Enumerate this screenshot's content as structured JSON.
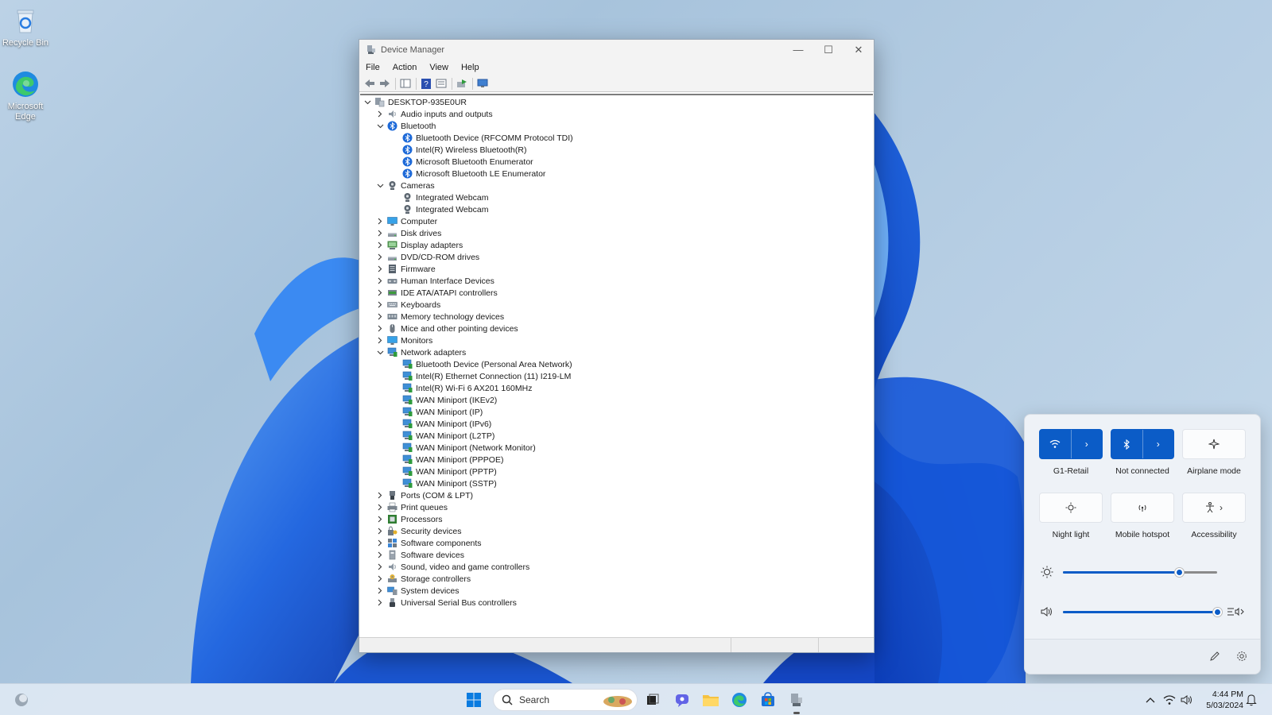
{
  "desktop": {
    "icons": [
      {
        "label": "Recycle Bin",
        "icon": "recycle-bin-icon"
      },
      {
        "label": "Microsoft Edge",
        "icon": "edge-icon"
      }
    ]
  },
  "window": {
    "title": "Device Manager",
    "menu": [
      "File",
      "Action",
      "View",
      "Help"
    ],
    "controls": {
      "minimize": "—",
      "maximize": "☐",
      "close": "✕"
    },
    "tree": [
      {
        "level": 0,
        "state": "expanded",
        "label": "DESKTOP-935E0UR",
        "icon": "computer"
      },
      {
        "level": 1,
        "state": "collapsed",
        "label": "Audio inputs and outputs",
        "icon": "audio"
      },
      {
        "level": 1,
        "state": "expanded",
        "label": "Bluetooth",
        "icon": "bluetooth"
      },
      {
        "level": 2,
        "state": "none",
        "label": "Bluetooth Device (RFCOMM Protocol TDI)",
        "icon": "bluetooth"
      },
      {
        "level": 2,
        "state": "none",
        "label": "Intel(R) Wireless Bluetooth(R)",
        "icon": "bluetooth"
      },
      {
        "level": 2,
        "state": "none",
        "label": "Microsoft Bluetooth Enumerator",
        "icon": "bluetooth"
      },
      {
        "level": 2,
        "state": "none",
        "label": "Microsoft Bluetooth LE Enumerator",
        "icon": "bluetooth"
      },
      {
        "level": 1,
        "state": "expanded",
        "label": "Cameras",
        "icon": "camera"
      },
      {
        "level": 2,
        "state": "none",
        "label": "Integrated Webcam",
        "icon": "camera"
      },
      {
        "level": 2,
        "state": "none",
        "label": "Integrated Webcam",
        "icon": "camera"
      },
      {
        "level": 1,
        "state": "collapsed",
        "label": "Computer",
        "icon": "monitor"
      },
      {
        "level": 1,
        "state": "collapsed",
        "label": "Disk drives",
        "icon": "disk"
      },
      {
        "level": 1,
        "state": "collapsed",
        "label": "Display adapters",
        "icon": "display"
      },
      {
        "level": 1,
        "state": "collapsed",
        "label": "DVD/CD-ROM drives",
        "icon": "disk"
      },
      {
        "level": 1,
        "state": "collapsed",
        "label": "Firmware",
        "icon": "firmware"
      },
      {
        "level": 1,
        "state": "collapsed",
        "label": "Human Interface Devices",
        "icon": "hid"
      },
      {
        "level": 1,
        "state": "collapsed",
        "label": "IDE ATA/ATAPI controllers",
        "icon": "ide"
      },
      {
        "level": 1,
        "state": "collapsed",
        "label": "Keyboards",
        "icon": "keyboard"
      },
      {
        "level": 1,
        "state": "collapsed",
        "label": "Memory technology devices",
        "icon": "memory"
      },
      {
        "level": 1,
        "state": "collapsed",
        "label": "Mice and other pointing devices",
        "icon": "mouse"
      },
      {
        "level": 1,
        "state": "collapsed",
        "label": "Monitors",
        "icon": "monitor"
      },
      {
        "level": 1,
        "state": "expanded",
        "label": "Network adapters",
        "icon": "network"
      },
      {
        "level": 2,
        "state": "none",
        "label": "Bluetooth Device (Personal Area Network)",
        "icon": "network"
      },
      {
        "level": 2,
        "state": "none",
        "label": "Intel(R) Ethernet Connection (11) I219-LM",
        "icon": "network"
      },
      {
        "level": 2,
        "state": "none",
        "label": "Intel(R) Wi-Fi 6 AX201 160MHz",
        "icon": "network"
      },
      {
        "level": 2,
        "state": "none",
        "label": "WAN Miniport (IKEv2)",
        "icon": "network"
      },
      {
        "level": 2,
        "state": "none",
        "label": "WAN Miniport (IP)",
        "icon": "network"
      },
      {
        "level": 2,
        "state": "none",
        "label": "WAN Miniport (IPv6)",
        "icon": "network"
      },
      {
        "level": 2,
        "state": "none",
        "label": "WAN Miniport (L2TP)",
        "icon": "network"
      },
      {
        "level": 2,
        "state": "none",
        "label": "WAN Miniport (Network Monitor)",
        "icon": "network"
      },
      {
        "level": 2,
        "state": "none",
        "label": "WAN Miniport (PPPOE)",
        "icon": "network"
      },
      {
        "level": 2,
        "state": "none",
        "label": "WAN Miniport (PPTP)",
        "icon": "network"
      },
      {
        "level": 2,
        "state": "none",
        "label": "WAN Miniport (SSTP)",
        "icon": "network"
      },
      {
        "level": 1,
        "state": "collapsed",
        "label": "Ports (COM & LPT)",
        "icon": "port"
      },
      {
        "level": 1,
        "state": "collapsed",
        "label": "Print queues",
        "icon": "printer"
      },
      {
        "level": 1,
        "state": "collapsed",
        "label": "Processors",
        "icon": "processor"
      },
      {
        "level": 1,
        "state": "collapsed",
        "label": "Security devices",
        "icon": "security"
      },
      {
        "level": 1,
        "state": "collapsed",
        "label": "Software components",
        "icon": "software"
      },
      {
        "level": 1,
        "state": "collapsed",
        "label": "Software devices",
        "icon": "softdev"
      },
      {
        "level": 1,
        "state": "collapsed",
        "label": "Sound, video and game controllers",
        "icon": "audio"
      },
      {
        "level": 1,
        "state": "collapsed",
        "label": "Storage controllers",
        "icon": "storage"
      },
      {
        "level": 1,
        "state": "collapsed",
        "label": "System devices",
        "icon": "system"
      },
      {
        "level": 1,
        "state": "collapsed",
        "label": "Universal Serial Bus controllers",
        "icon": "usb"
      }
    ]
  },
  "quick_settings": {
    "tiles": [
      {
        "label": "G1-Retail",
        "icon": "wifi-icon",
        "on": true,
        "split": true
      },
      {
        "label": "Not connected",
        "icon": "bluetooth-icon",
        "on": true,
        "split": true
      },
      {
        "label": "Airplane mode",
        "icon": "airplane-icon",
        "on": false,
        "split": false
      },
      {
        "label": "Night light",
        "icon": "night-light-icon",
        "on": false,
        "split": false
      },
      {
        "label": "Mobile hotspot",
        "icon": "hotspot-icon",
        "on": false,
        "split": false
      },
      {
        "label": "Accessibility",
        "icon": "accessibility-icon",
        "on": false,
        "split": false
      }
    ],
    "brightness_level": 0.75,
    "volume_level": 1.0,
    "accent": "#0b5cc7"
  },
  "taskbar": {
    "search_placeholder": "Search",
    "time": "4:44 PM",
    "date": "5/03/2024"
  }
}
